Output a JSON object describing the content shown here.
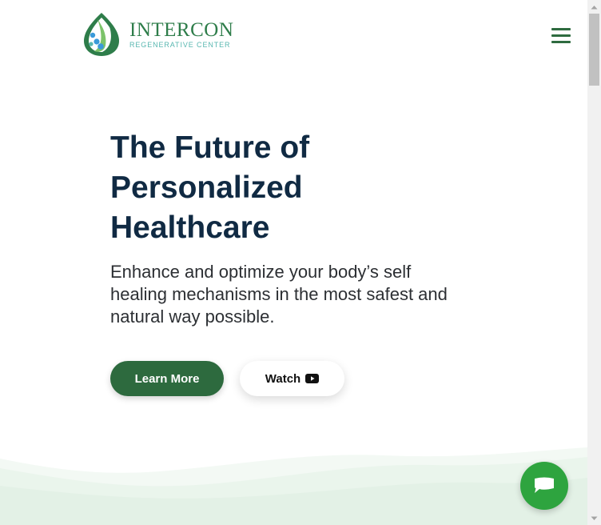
{
  "header": {
    "logo_title": "INTERCON",
    "logo_subtitle": "REGENERATIVE CENTER",
    "menu_icon": "hamburger-menu-icon"
  },
  "hero": {
    "title_lines": [
      "The Future of",
      "Personalized",
      "Healthcare"
    ],
    "subtitle_lines": [
      "Enhance and optimize your body’s self",
      "healing mechanisms in the most safest and",
      "natural way possible."
    ],
    "learn_more_label": "Learn More",
    "watch_label": "Watch",
    "watch_icon": "youtube-play-icon"
  },
  "chat": {
    "icon": "chat-bubble-icon"
  },
  "colors": {
    "brand_green": "#2d6a3e",
    "logo_green": "#2e7d4a",
    "logo_teal": "#58b7b0",
    "heading": "#102a43",
    "chat_green": "#2ea43f",
    "wave_tint": "#eef6f0"
  }
}
